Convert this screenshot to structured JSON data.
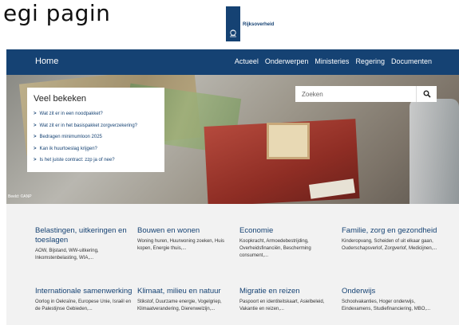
{
  "caption": "egi pagin",
  "logo": {
    "name": "Rijksoverheid"
  },
  "nav": {
    "home": "Home",
    "items": [
      "Actueel",
      "Onderwerpen",
      "Ministeries",
      "Regering",
      "Documenten"
    ]
  },
  "hero": {
    "credit": "Beeld: ©ANP"
  },
  "veel_bekeken": {
    "title": "Veel bekeken",
    "items": [
      "Wat zit er in een noodpakket?",
      "Wat zit er in het basispakket zorgverzekering?",
      "Bedragen minimumloon 2025",
      "Kan ik huurtoeslag krijgen?",
      "Is het juiste contract: zzp ja of nee?"
    ]
  },
  "search": {
    "placeholder": "Zoeken"
  },
  "topics": [
    {
      "title": "Belastingen, uitkeringen en toeslagen",
      "desc": "AOW, Bijstand, WW-uitkering, Inkomstenbelasting, WIA,..."
    },
    {
      "title": "Bouwen en wonen",
      "desc": "Woning huren, Huurwoning zoeken, Huis kopen, Energie thuis,..."
    },
    {
      "title": "Economie",
      "desc": "Koopkracht, Armoedebestrijding, Overheidsfinanciën, Bescherming consument,..."
    },
    {
      "title": "Familie, zorg en gezondheid",
      "desc": "Kinderopvang, Scheiden of uit elkaar gaan, Ouderschapsverlof, Zorgverlof, Medicijnen,..."
    },
    {
      "title": "Internationale samenwerking",
      "desc": "Oorlog in Oekraïne, Europese Unie, Israël en de Palestijnse Gebieden,..."
    },
    {
      "title": "Klimaat, milieu en natuur",
      "desc": "Stikstof, Duurzame energie, Vogelgriep, Klimaatverandering, Dierenwelzijn,..."
    },
    {
      "title": "Migratie en reizen",
      "desc": "Paspoort en identiteitskaart, Asielbeleid, Vakantie en reizen,..."
    },
    {
      "title": "Onderwijs",
      "desc": "Schoolvakanties, Hoger onderwijs, Eindexamens, Studiefinanciering, MBO,..."
    }
  ],
  "colors": {
    "brand": "#154273",
    "grid_bg": "#f2f2f2"
  }
}
